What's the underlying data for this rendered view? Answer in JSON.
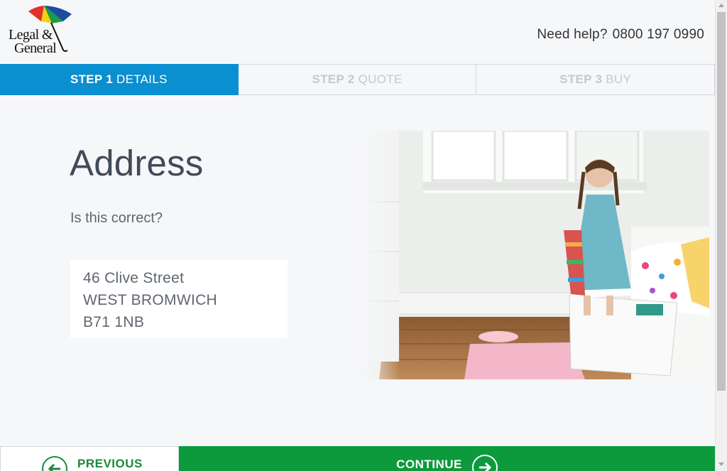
{
  "brand": {
    "logo_line1": "Legal &",
    "logo_line2": "General"
  },
  "help": {
    "label": "Need help?",
    "phone": "0800 197 0990"
  },
  "steps": [
    {
      "num": "STEP 1",
      "label": "DETAILS",
      "active": true
    },
    {
      "num": "STEP 2",
      "label": "QUOTE",
      "active": false
    },
    {
      "num": "STEP 3",
      "label": "BUY",
      "active": false
    }
  ],
  "main": {
    "title": "Address",
    "question": "Is this correct?",
    "address": {
      "line1": "46 Clive Street",
      "line2": "WEST BROMWICH",
      "line3": "B71 1NB"
    }
  },
  "buttons": {
    "previous": "PREVIOUS",
    "continue": "CONTINUE"
  },
  "colors": {
    "step_active": "#0a8fd0",
    "continue_green": "#0c9a3c",
    "page_bg": "#f6f7f9"
  }
}
